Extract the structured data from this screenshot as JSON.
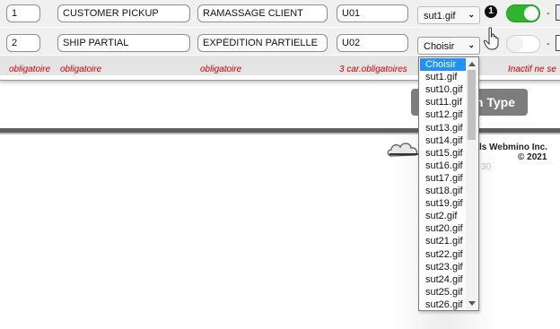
{
  "rows": [
    {
      "order": "1",
      "name_en": "CUSTOMER PICKUP",
      "name_fr": "RAMASSAGE CLIENT",
      "code": "U01",
      "image": "sut1.gif",
      "badge": "1",
      "toggle": "on",
      "separator": "-"
    },
    {
      "order": "2",
      "name_en": "SHIP PARTIAL",
      "name_fr": "EXPÉDITION PARTIELLE",
      "code": "U02",
      "image": "Choisir",
      "toggle": "off",
      "separator": "-"
    }
  ],
  "help_row": {
    "col1": "obligatoire",
    "col2": "obligatoire",
    "col3": "obligatoire",
    "col4": "3 car.obligatoires",
    "col6": "Inactif ne se"
  },
  "add_button": {
    "label": "n Type"
  },
  "footer": {
    "copyright_line1": "ls Webmino Inc.",
    "copyright_line2": "© 2021",
    "faint_text": "30",
    "logo": "webmino-cloud-logo"
  },
  "image_dropdown": {
    "options": [
      "Choisir",
      "sut1.gif",
      "sut10.gif",
      "sut11.gif",
      "sut12.gif",
      "sut13.gif",
      "sut14.gif",
      "sut15.gif",
      "sut16.gif",
      "sut17.gif",
      "sut18.gif",
      "sut19.gif",
      "sut2.gif",
      "sut20.gif",
      "sut21.gif",
      "sut22.gif",
      "sut23.gif",
      "sut24.gif",
      "sut25.gif",
      "sut26.gif"
    ],
    "selected_index": 0
  },
  "colors": {
    "toggle_on": "#2db52d",
    "help_text": "#d40000",
    "selected_option": "#1e90ff",
    "button_bg": "#7d7d7d"
  },
  "icons": {
    "cursor": "hand-pointer-icon",
    "chevron": "chevron-down-icon",
    "badge": "number-one-badge-icon"
  }
}
